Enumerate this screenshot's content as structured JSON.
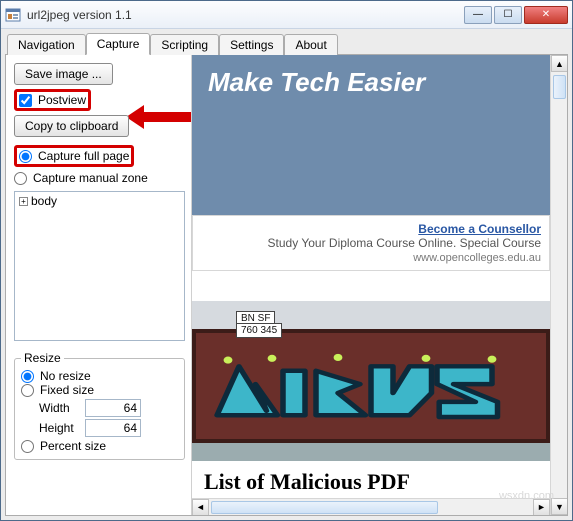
{
  "window": {
    "title": "url2jpeg version 1.1"
  },
  "tabs": [
    "Navigation",
    "Capture",
    "Scripting",
    "Settings",
    "About"
  ],
  "active_tab": 1,
  "left": {
    "save_btn": "Save image ...",
    "postview": "Postview",
    "copy_btn": "Copy to clipboard",
    "capture_full": "Capture full page",
    "capture_manual": "Capture manual zone",
    "tree_root": "body",
    "resize": {
      "legend": "Resize",
      "no_resize": "No resize",
      "fixed": "Fixed size",
      "width_label": "Width",
      "width_value": "64",
      "height_label": "Height",
      "height_value": "64",
      "percent": "Percent size"
    }
  },
  "preview": {
    "banner_title": "Make Tech Easier",
    "ad_link": "Become a Counsellor",
    "ad_line": "Study Your Diploma Course Online. Special Course",
    "ad_domain": "www.opencolleges.edu.au",
    "train_reporting1": "BN SF",
    "train_reporting2": "760 345",
    "article_title_partial": "List of Malicious PDF"
  },
  "watermark": "wsxdn.com"
}
